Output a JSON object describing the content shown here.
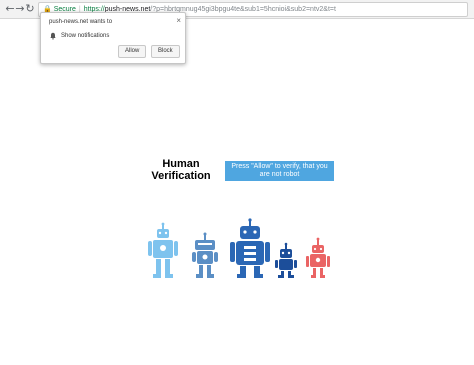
{
  "browser": {
    "back_icon": "arrow-left-icon",
    "forward_icon": "arrow-right-icon",
    "reload_icon": "reload-icon",
    "secure_label": "Secure",
    "url_scheme": "https://",
    "url_host": "push-news.net",
    "url_rest": "/?p=hbrtqmnug45gi3bpgu4te&sub1=5hcnioi&sub2=ntv2&t=t"
  },
  "popup": {
    "title": "push-news.net wants to",
    "permission_label": "Show notifications",
    "allow_label": "Allow",
    "block_label": "Block",
    "close_label": "×"
  },
  "page": {
    "title_line1": "Human",
    "title_line2": "Verification",
    "press_label": "Press \"Allow\" to verify, that you are not robot"
  },
  "colors": {
    "robot_light_blue": "#7ec3ee",
    "robot_mid_blue": "#5b8fc5",
    "robot_dark_blue": "#2b67b5",
    "robot_navy": "#1c4e9a",
    "robot_red": "#ea6464",
    "button_blue": "#4fa6e0",
    "secure_green": "#0b8043"
  }
}
